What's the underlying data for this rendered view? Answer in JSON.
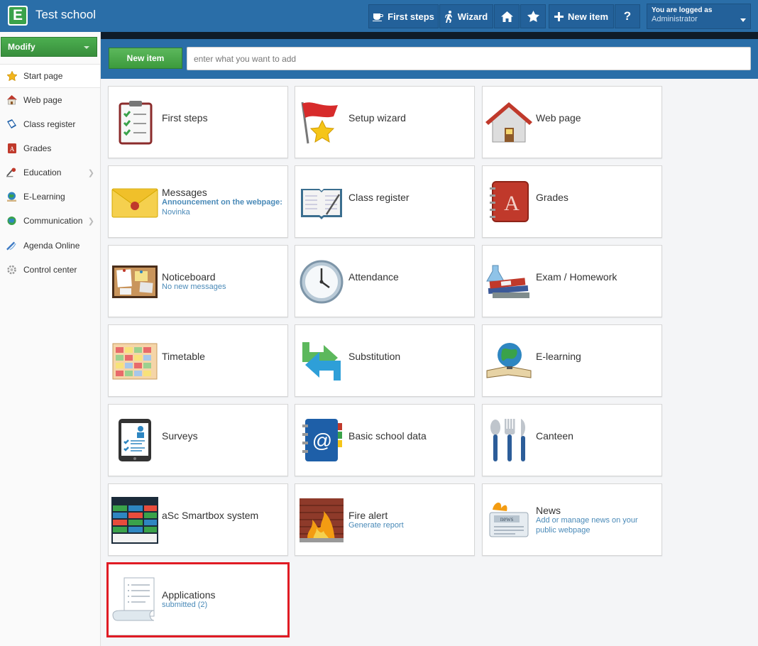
{
  "app": {
    "logo_letter": "E",
    "school_name": "Test school"
  },
  "toolbar": {
    "first_steps": "First steps",
    "wizard": "Wizard",
    "new_item": "New item",
    "help": "?",
    "user_line1": "You are logged as",
    "user_line2": "Administrator"
  },
  "addbar": {
    "button": "New item",
    "placeholder": "enter what you want to add"
  },
  "sidebar": {
    "modify": "Modify",
    "items": [
      {
        "label": "Start page",
        "icon": "star-icon"
      },
      {
        "label": "Web page",
        "icon": "webpage-icon"
      },
      {
        "label": "Class register",
        "icon": "class-register-icon"
      },
      {
        "label": "Grades",
        "icon": "grades-icon"
      },
      {
        "label": "Education",
        "icon": "education-icon"
      },
      {
        "label": "E-Learning",
        "icon": "elearning-icon"
      },
      {
        "label": "Communication",
        "icon": "communication-icon"
      },
      {
        "label": "Agenda Online",
        "icon": "agenda-icon"
      },
      {
        "label": "Control center",
        "icon": "control-center-icon"
      }
    ]
  },
  "tiles": [
    {
      "title": "First steps",
      "sub1": "",
      "sub2": "",
      "icon": "checklist-icon"
    },
    {
      "title": "Setup wizard",
      "sub1": "",
      "sub2": "",
      "icon": "flag-star-icon"
    },
    {
      "title": "Web page",
      "sub1": "",
      "sub2": "",
      "icon": "house-icon"
    },
    {
      "title": "Messages",
      "sub1": "Announcement on the webpage:",
      "sub2": "Novinka",
      "icon": "envelope-icon"
    },
    {
      "title": "Class register",
      "sub1": "",
      "sub2": "",
      "icon": "open-book-icon"
    },
    {
      "title": "Grades",
      "sub1": "",
      "sub2": "",
      "icon": "grade-book-icon"
    },
    {
      "title": "Noticeboard",
      "sub1": "No new messages",
      "sub2": "",
      "icon": "corkboard-icon"
    },
    {
      "title": "Attendance",
      "sub1": "",
      "sub2": "",
      "icon": "clock-icon"
    },
    {
      "title": "Exam / Homework",
      "sub1": "",
      "sub2": "",
      "icon": "books-flask-icon"
    },
    {
      "title": "Timetable",
      "sub1": "",
      "sub2": "",
      "icon": "timetable-icon"
    },
    {
      "title": "Substitution",
      "sub1": "",
      "sub2": "",
      "icon": "swap-arrows-icon"
    },
    {
      "title": "E-learning",
      "sub1": "",
      "sub2": "",
      "icon": "globe-book-icon"
    },
    {
      "title": "Surveys",
      "sub1": "",
      "sub2": "",
      "icon": "tablet-survey-icon"
    },
    {
      "title": "Basic school data",
      "sub1": "",
      "sub2": "",
      "icon": "address-book-icon"
    },
    {
      "title": "Canteen",
      "sub1": "",
      "sub2": "",
      "icon": "cutlery-icon"
    },
    {
      "title": "aSc Smartbox system",
      "sub1": "",
      "sub2": "",
      "icon": "smartbox-screen-icon"
    },
    {
      "title": "Fire alert",
      "sub1": "Generate report",
      "sub2": "",
      "icon": "fire-wall-icon"
    },
    {
      "title": "News",
      "sub1": "Add or manage news on your public webpage",
      "sub2": "",
      "icon": "newspaper-icon"
    },
    {
      "title": "Applications",
      "sub1": "submitted (2)",
      "sub2": "",
      "icon": "scroll-document-icon"
    }
  ]
}
